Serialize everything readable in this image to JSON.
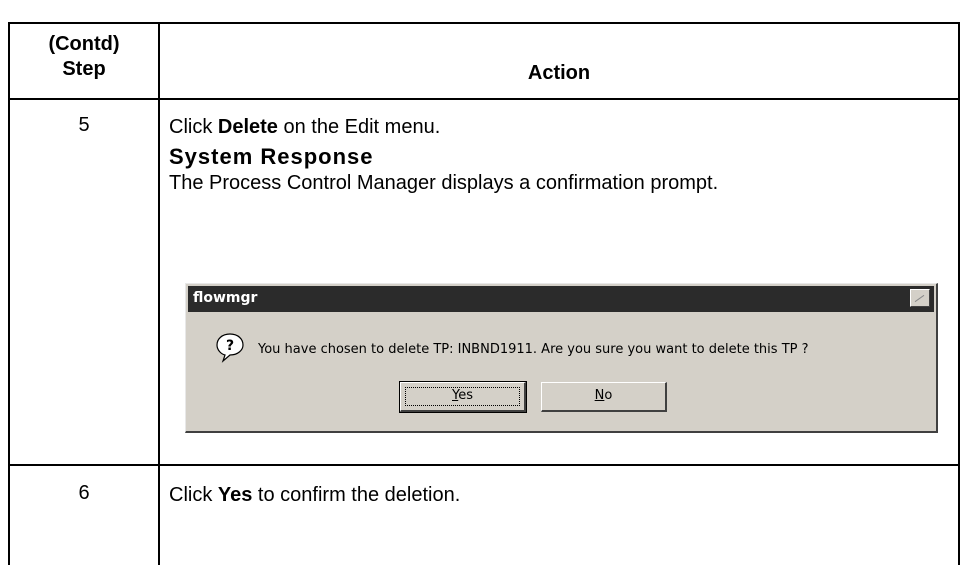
{
  "table": {
    "header": {
      "step_line1": "(Contd)",
      "step_line2": "Step",
      "action": "Action"
    },
    "rows": [
      {
        "step": "5",
        "action_prefix": "Click ",
        "action_bold": "Delete",
        "action_suffix": " on the Edit menu.",
        "system_response_heading": "System Response",
        "system_response_text": "The Process Control Manager displays a confirmation prompt."
      },
      {
        "step": "6",
        "action_prefix": "Click ",
        "action_bold": "Yes",
        "action_suffix": " to confirm the deletion."
      }
    ]
  },
  "dialog": {
    "title": "flowmgr",
    "icon": "question-icon",
    "message": "You have chosen to delete TP: INBND1911.  Are you sure you want to delete this TP ?",
    "buttons": {
      "yes_mnemonic": "Y",
      "yes_rest": "es",
      "no_mnemonic": "N",
      "no_rest": "o"
    }
  },
  "colors": {
    "dialog_face": "#d4d0c8",
    "titlebar": "#2b2b2b",
    "title_text": "#ffffff"
  }
}
